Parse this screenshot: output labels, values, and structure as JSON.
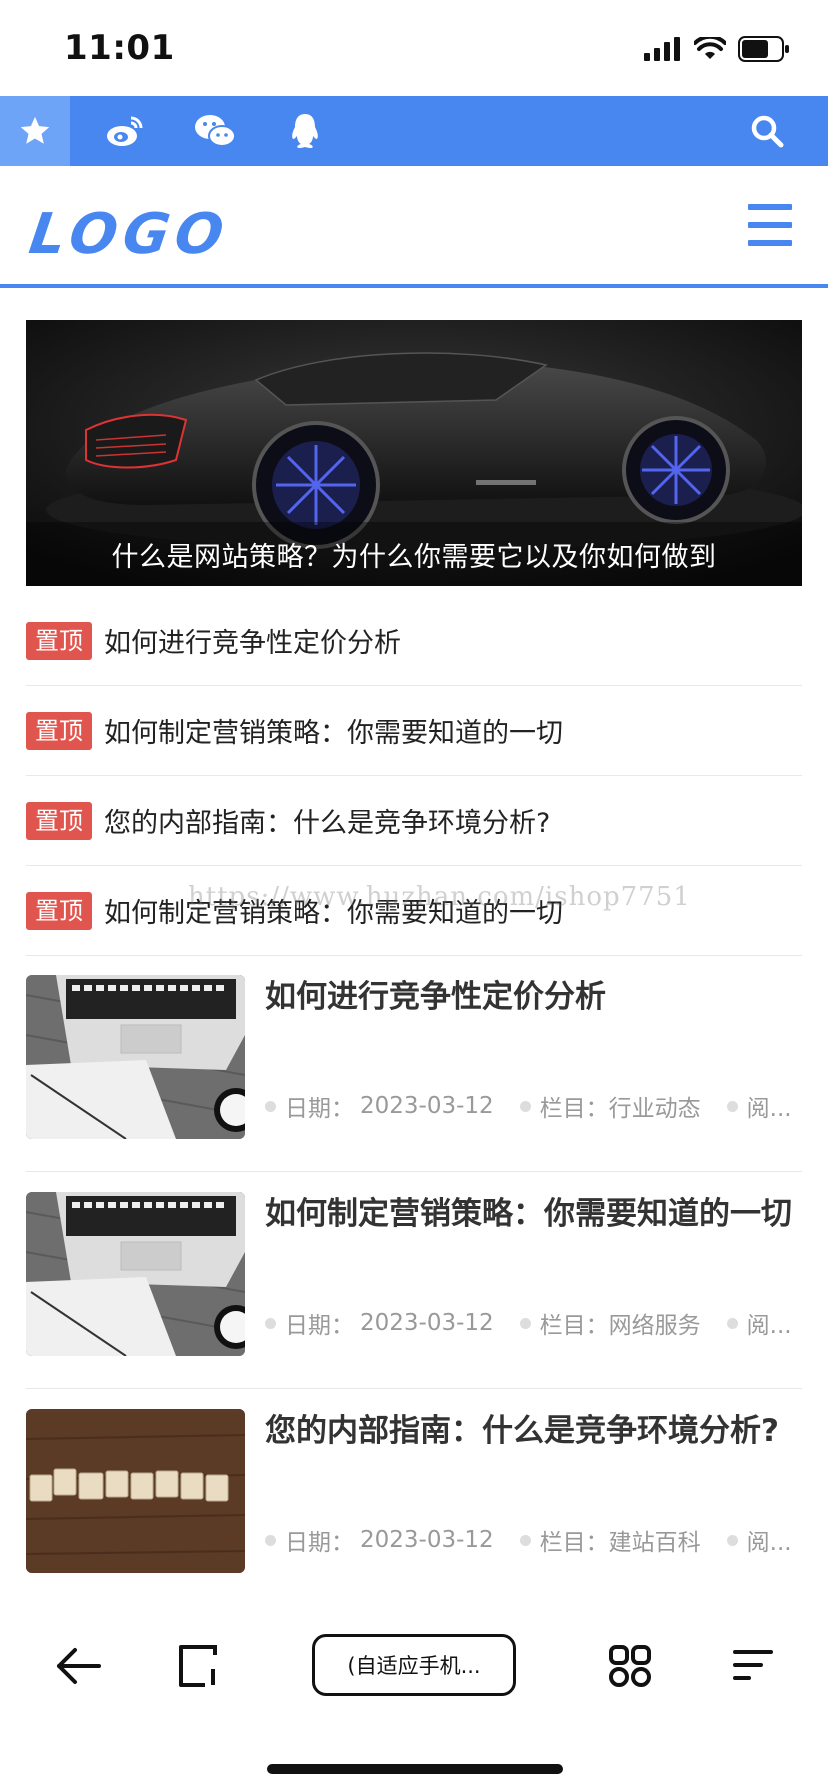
{
  "status_bar": {
    "time": "11:01"
  },
  "social_bar": {
    "items": [
      {
        "icon": "star-icon"
      },
      {
        "icon": "weibo-icon"
      },
      {
        "icon": "wechat-icon"
      },
      {
        "icon": "qq-icon"
      }
    ],
    "search_icon": "search-icon",
    "accent_color": "#4887ef"
  },
  "header": {
    "logo": "LOGO",
    "menu_icon": "hamburger-menu-icon"
  },
  "banner": {
    "caption": "什么是网站策略？为什么你需要它以及你如何做到"
  },
  "pinned": {
    "badge": "置顶",
    "items": [
      {
        "title": "如何进行竞争性定价分析"
      },
      {
        "title": "如何制定营销策略：你需要知道的一切"
      },
      {
        "title": "您的内部指南：什么是竞争环境分析?"
      },
      {
        "title": "如何制定营销策略：你需要知道的一切"
      }
    ]
  },
  "watermark": "https://www.huzhan.com/ishop7751",
  "articles": [
    {
      "title": "如何进行竞争性定价分析",
      "date_label": "日期：",
      "date": "2023-03-12",
      "category_label": "栏目：",
      "category": "行业动态",
      "reads_label": "阅..."
    },
    {
      "title": "如何制定营销策略：你需要知道的一切",
      "date_label": "日期：",
      "date": "2023-03-12",
      "category_label": "栏目：",
      "category": "网络服务",
      "reads_label": "阅..."
    },
    {
      "title": "您的内部指南：什么是竞争环境分析?",
      "date_label": "日期：",
      "date": "2023-03-12",
      "category_label": "栏目：",
      "category": "建站百科",
      "reads_label": "阅..."
    }
  ],
  "browser_bar": {
    "address": "(自适应手机...",
    "back_icon": "back-arrow-icon",
    "tabs_icon": "tabs-icon",
    "grid_icon": "grid-apps-icon",
    "menu_icon": "menu-lines-icon"
  }
}
